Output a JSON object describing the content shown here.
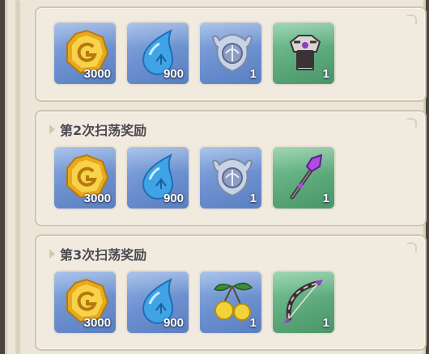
{
  "panels": [
    {
      "title": "",
      "items": [
        {
          "icon": "coin-icon",
          "count": "3000",
          "rarity": "blue"
        },
        {
          "icon": "water-drop-icon",
          "count": "900",
          "rarity": "blue"
        },
        {
          "icon": "emblem-icon",
          "count": "1",
          "rarity": "blue"
        },
        {
          "icon": "armor-icon",
          "count": "1",
          "rarity": "green"
        }
      ]
    },
    {
      "title": "第2次扫荡奖励",
      "items": [
        {
          "icon": "coin-icon",
          "count": "3000",
          "rarity": "blue"
        },
        {
          "icon": "water-drop-icon",
          "count": "900",
          "rarity": "blue"
        },
        {
          "icon": "emblem-icon",
          "count": "1",
          "rarity": "blue"
        },
        {
          "icon": "staff-icon",
          "count": "1",
          "rarity": "green"
        }
      ]
    },
    {
      "title": "第3次扫荡奖励",
      "items": [
        {
          "icon": "coin-icon",
          "count": "3000",
          "rarity": "blue"
        },
        {
          "icon": "water-drop-icon",
          "count": "900",
          "rarity": "blue"
        },
        {
          "icon": "fruit-icon",
          "count": "1",
          "rarity": "blue"
        },
        {
          "icon": "bow-icon",
          "count": "1",
          "rarity": "green"
        }
      ]
    }
  ]
}
